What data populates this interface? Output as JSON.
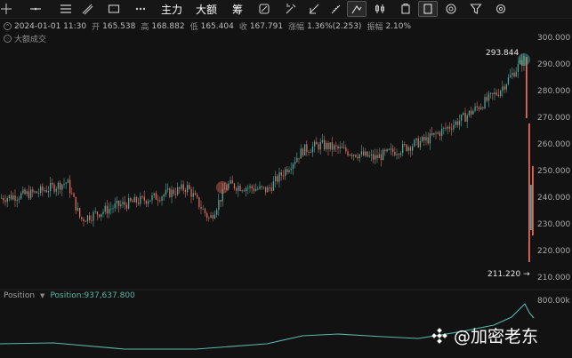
{
  "toolbar": {
    "items": [
      {
        "type": "icon",
        "name": "crosshair-icon"
      },
      {
        "type": "icon",
        "name": "horizontal-line-icon"
      },
      {
        "type": "icon",
        "name": "parallel-lines-icon"
      },
      {
        "type": "icon",
        "name": "trend-line-icon"
      },
      {
        "type": "icon",
        "name": "rectangle-icon"
      },
      {
        "type": "icon",
        "name": "more-icon"
      },
      {
        "type": "text",
        "label": "主力"
      },
      {
        "type": "text",
        "label": "大额"
      },
      {
        "type": "text",
        "label": "筹"
      },
      {
        "type": "icon",
        "name": "indicator-icon"
      },
      {
        "type": "icon",
        "name": "brush-icon"
      },
      {
        "type": "icon",
        "name": "measure-icon"
      },
      {
        "type": "icon",
        "name": "ruler-icon"
      },
      {
        "type": "icon",
        "name": "draw-active-icon",
        "active": true
      },
      {
        "type": "icon",
        "name": "candles-icon"
      },
      {
        "type": "icon",
        "name": "copy-icon"
      },
      {
        "type": "icon",
        "name": "layout-icon",
        "active": true
      },
      {
        "type": "icon",
        "name": "camera-icon"
      },
      {
        "type": "icon",
        "name": "filter-icon"
      },
      {
        "type": "icon",
        "name": "settings-icon"
      }
    ]
  },
  "ohlc": {
    "datetime": "2024-01-01 11:30",
    "open_label": "开",
    "open": "165.538",
    "high_label": "高",
    "high": "168.882",
    "low_label": "低",
    "low": "165.404",
    "close_label": "收",
    "close": "167.791",
    "change_label": "涨幅",
    "change": "1.36%(2.253)",
    "amp_label": "振幅",
    "amp": "2.10%"
  },
  "indicator": {
    "label": "大额成交"
  },
  "price_axis": [
    "300.000",
    "290.000",
    "280.000",
    "270.000",
    "260.000",
    "250.000",
    "240.000",
    "230.000",
    "220.000",
    "210.000"
  ],
  "markers": {
    "high": "293.844",
    "low": "211.220 →"
  },
  "position_panel": {
    "name": "Position",
    "value_label": "Position:937,637.800",
    "axis_label": "800.00k"
  },
  "watermark": {
    "text": "@加密老东"
  },
  "colors": {
    "up": "#4fa69b",
    "down": "#e06a5d",
    "position_line": "#58b8a8",
    "background": "#121212"
  }
}
